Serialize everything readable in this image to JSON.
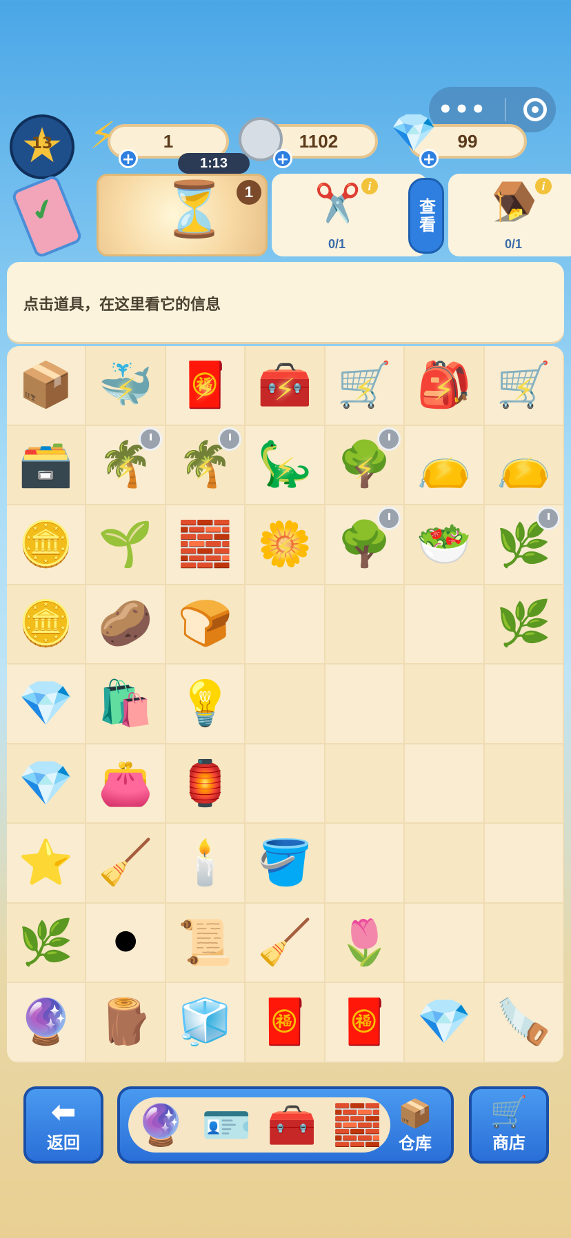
{
  "top": {
    "menu_dots": "•••",
    "level": "13",
    "energy": {
      "value": "1",
      "timer": "1:13",
      "plus": "+"
    },
    "coins": {
      "value": "1102",
      "plus": "+"
    },
    "gems": {
      "value": "99",
      "plus": "+"
    }
  },
  "orders": {
    "hourglass_badge": "1",
    "card2_count": "0/1",
    "card3_count": "0/1",
    "view_button": "查看",
    "info_glyph": "i"
  },
  "info_panel": {
    "text": "点击道具，在这里看它的信息"
  },
  "board": {
    "rows": [
      [
        {
          "icon": "📦"
        },
        {
          "icon": "🐳",
          "bolt": true
        },
        {
          "icon": "🧧",
          "bolt": true
        },
        {
          "icon": "🧰",
          "bolt": true
        },
        {
          "icon": "🛒",
          "bolt": true
        },
        {
          "icon": "🎒",
          "bolt": true
        },
        {
          "icon": "🛒",
          "bolt": true
        }
      ],
      [
        {
          "icon": "🗃️"
        },
        {
          "icon": "🌴",
          "bolt": true,
          "clock": true
        },
        {
          "icon": "🌴",
          "bolt": true,
          "clock": true
        },
        {
          "icon": "🦕",
          "bolt": true
        },
        {
          "icon": "🌳",
          "bolt": true,
          "clock": true
        },
        {
          "icon": "👝",
          "bolt": true
        },
        {
          "icon": "👝",
          "bolt": true
        }
      ],
      [
        {
          "icon": "🪙"
        },
        {
          "icon": "🌱"
        },
        {
          "icon": "🧱"
        },
        {
          "icon": "🌼",
          "bolt": true
        },
        {
          "icon": "🌳",
          "clock": true
        },
        {
          "icon": "🥗"
        },
        {
          "icon": "🌿",
          "clock": true
        }
      ],
      [
        {
          "icon": "🪙"
        },
        {
          "icon": "🥔"
        },
        {
          "icon": "🍞"
        },
        {
          "icon": ""
        },
        {
          "icon": ""
        },
        {
          "icon": ""
        },
        {
          "icon": "🌿"
        }
      ],
      [
        {
          "icon": "💎"
        },
        {
          "icon": "🛍️"
        },
        {
          "icon": "💡"
        },
        {
          "icon": ""
        },
        {
          "icon": ""
        },
        {
          "icon": ""
        },
        {
          "icon": ""
        }
      ],
      [
        {
          "icon": "💎"
        },
        {
          "icon": "👛"
        },
        {
          "icon": "🏮"
        },
        {
          "icon": ""
        },
        {
          "icon": ""
        },
        {
          "icon": ""
        },
        {
          "icon": ""
        }
      ],
      [
        {
          "icon": "⭐"
        },
        {
          "icon": "🧹"
        },
        {
          "icon": "🕯️"
        },
        {
          "icon": "🪣"
        },
        {
          "icon": ""
        },
        {
          "icon": ""
        },
        {
          "icon": ""
        }
      ],
      [
        {
          "icon": "🌿"
        },
        {
          "icon": "⚫"
        },
        {
          "icon": "📜"
        },
        {
          "icon": "🧹"
        },
        {
          "icon": "🌷"
        },
        {
          "icon": ""
        },
        {
          "icon": ""
        }
      ],
      [
        {
          "icon": "🔮"
        },
        {
          "icon": "🪵"
        },
        {
          "icon": "🧊"
        },
        {
          "icon": "🧧"
        },
        {
          "icon": "🧧"
        },
        {
          "icon": "💎"
        },
        {
          "icon": "🪚"
        }
      ]
    ]
  },
  "bottom": {
    "back_label": "返回",
    "warehouse_label": "仓库",
    "shop_label": "商店",
    "tray_icons": [
      "🔮",
      "🪪",
      "🧰",
      "🧱"
    ]
  }
}
